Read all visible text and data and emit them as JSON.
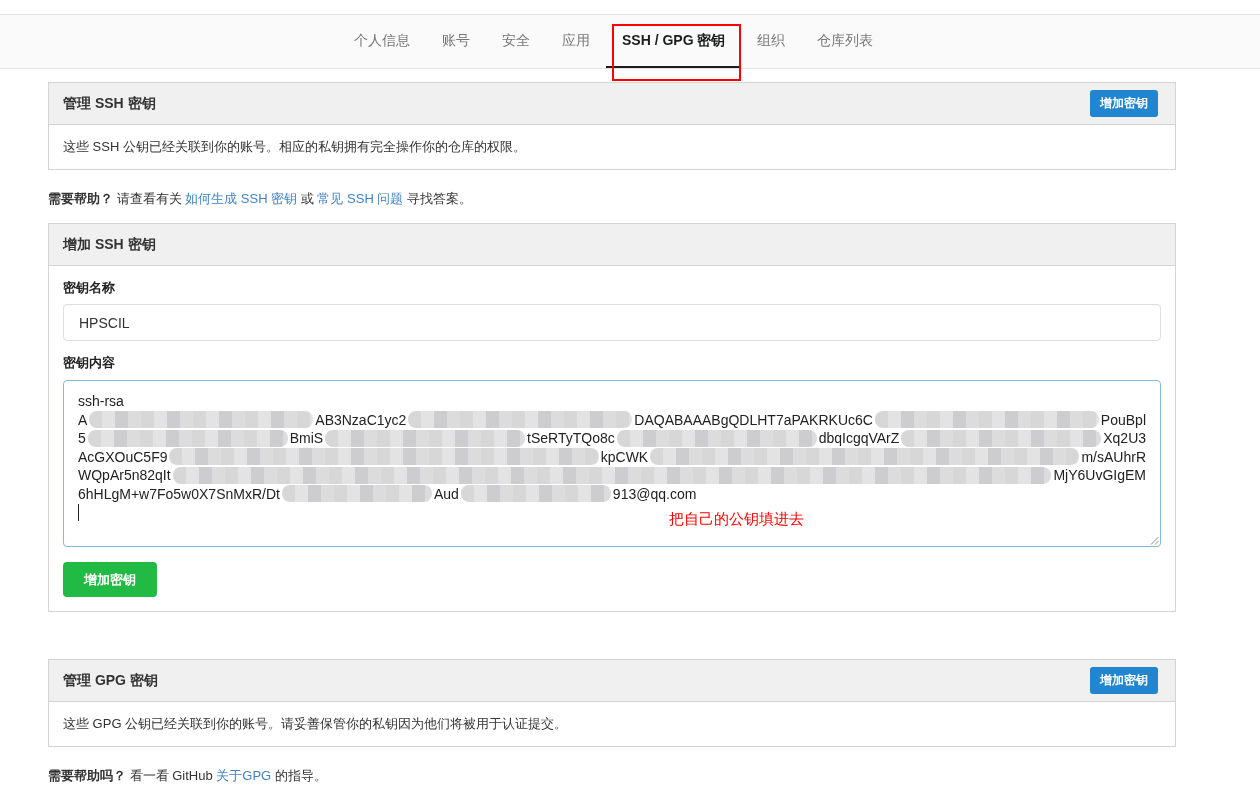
{
  "tabs": [
    {
      "label": "个人信息",
      "selected": false,
      "highlighted": false
    },
    {
      "label": "账号",
      "selected": false,
      "highlighted": false
    },
    {
      "label": "安全",
      "selected": false,
      "highlighted": false
    },
    {
      "label": "应用",
      "selected": false,
      "highlighted": false
    },
    {
      "label": "SSH / GPG 密钥",
      "selected": true,
      "highlighted": true
    },
    {
      "label": "组织",
      "selected": false,
      "highlighted": false
    },
    {
      "label": "仓库列表",
      "selected": false,
      "highlighted": false
    }
  ],
  "ssh_keys_card": {
    "title": "管理 SSH 密钥",
    "button": "增加密钥",
    "description": "这些 SSH 公钥已经关联到你的账号。相应的私钥拥有完全操作你的仓库的权限。"
  },
  "ssh_help": [
    {
      "kind": "text",
      "text": "**需要帮助？** 请查看有关 "
    },
    {
      "kind": "link",
      "text": "如何生成 SSH 密钥"
    },
    {
      "kind": "text",
      "text": " 或 "
    },
    {
      "kind": "link",
      "text": "常见 SSH 问题"
    },
    {
      "kind": "text",
      "text": " 寻找答案。"
    }
  ],
  "add_ssh_key_card": {
    "title": "增加 SSH 密钥",
    "fields": [
      {
        "kind": "input",
        "label": "密钥名称",
        "value": "HPSCIL"
      },
      {
        "kind": "textarea",
        "label": "密钥内容",
        "focused": true,
        "annotation": "把自己的公钥填进去",
        "lines": [
          [
            {
              "kind": "text",
              "text": "ssh-rsa"
            }
          ],
          [
            {
              "kind": "text",
              "text": "A"
            },
            {
              "kind": "redacted"
            },
            {
              "kind": "text",
              "text": "AB3NzaC1yc2"
            },
            {
              "kind": "redacted"
            },
            {
              "kind": "text",
              "text": "DAQABAAABgQDLHT7aPAKRKUc6C"
            },
            {
              "kind": "redacted"
            },
            {
              "kind": "text",
              "text": "PouBpl"
            }
          ],
          [
            {
              "kind": "text",
              "text": "5"
            },
            {
              "kind": "redacted"
            },
            {
              "kind": "text",
              "text": "BmiS"
            },
            {
              "kind": "redacted"
            },
            {
              "kind": "text",
              "text": "tSeRTyTQo8c"
            },
            {
              "kind": "redacted"
            },
            {
              "kind": "text",
              "text": "dbqIcgqVArZ"
            },
            {
              "kind": "redacted"
            },
            {
              "kind": "text",
              "text": "Xq2U3"
            }
          ],
          [
            {
              "kind": "text",
              "text": "AcGXOuC5F9"
            },
            {
              "kind": "redacted"
            },
            {
              "kind": "text",
              "text": "kpCWK"
            },
            {
              "kind": "redacted"
            },
            {
              "kind": "text",
              "text": "m/sAUhrR"
            }
          ],
          [
            {
              "kind": "text",
              "text": "WQpAr5n82qIt"
            },
            {
              "kind": "redacted"
            },
            {
              "kind": "text",
              "text": "MjY6UvGIgEM"
            }
          ],
          [
            {
              "kind": "text",
              "text": "6hHLgM+w7Fo5w0X7SnMxR/Dt"
            },
            {
              "kind": "redacted"
            },
            {
              "kind": "text",
              "text": "Aud"
            },
            {
              "kind": "redacted"
            },
            {
              "kind": "text",
              "text": "913@qq.com"
            }
          ]
        ]
      }
    ],
    "button": "增加密钥"
  },
  "gpg_keys_card": {
    "title": "管理 GPG 密钥",
    "button": "增加密钥",
    "description": "这些 GPG 公钥已经关联到你的账号。请妥善保管你的私钥因为他们将被用于认证提交。"
  },
  "gpg_help": [
    {
      "kind": "text",
      "text": "**需要帮助吗？** 看一看 GitHub "
    },
    {
      "kind": "link",
      "text": "关于GPG"
    },
    {
      "kind": "text",
      "text": " 的指导。"
    }
  ]
}
